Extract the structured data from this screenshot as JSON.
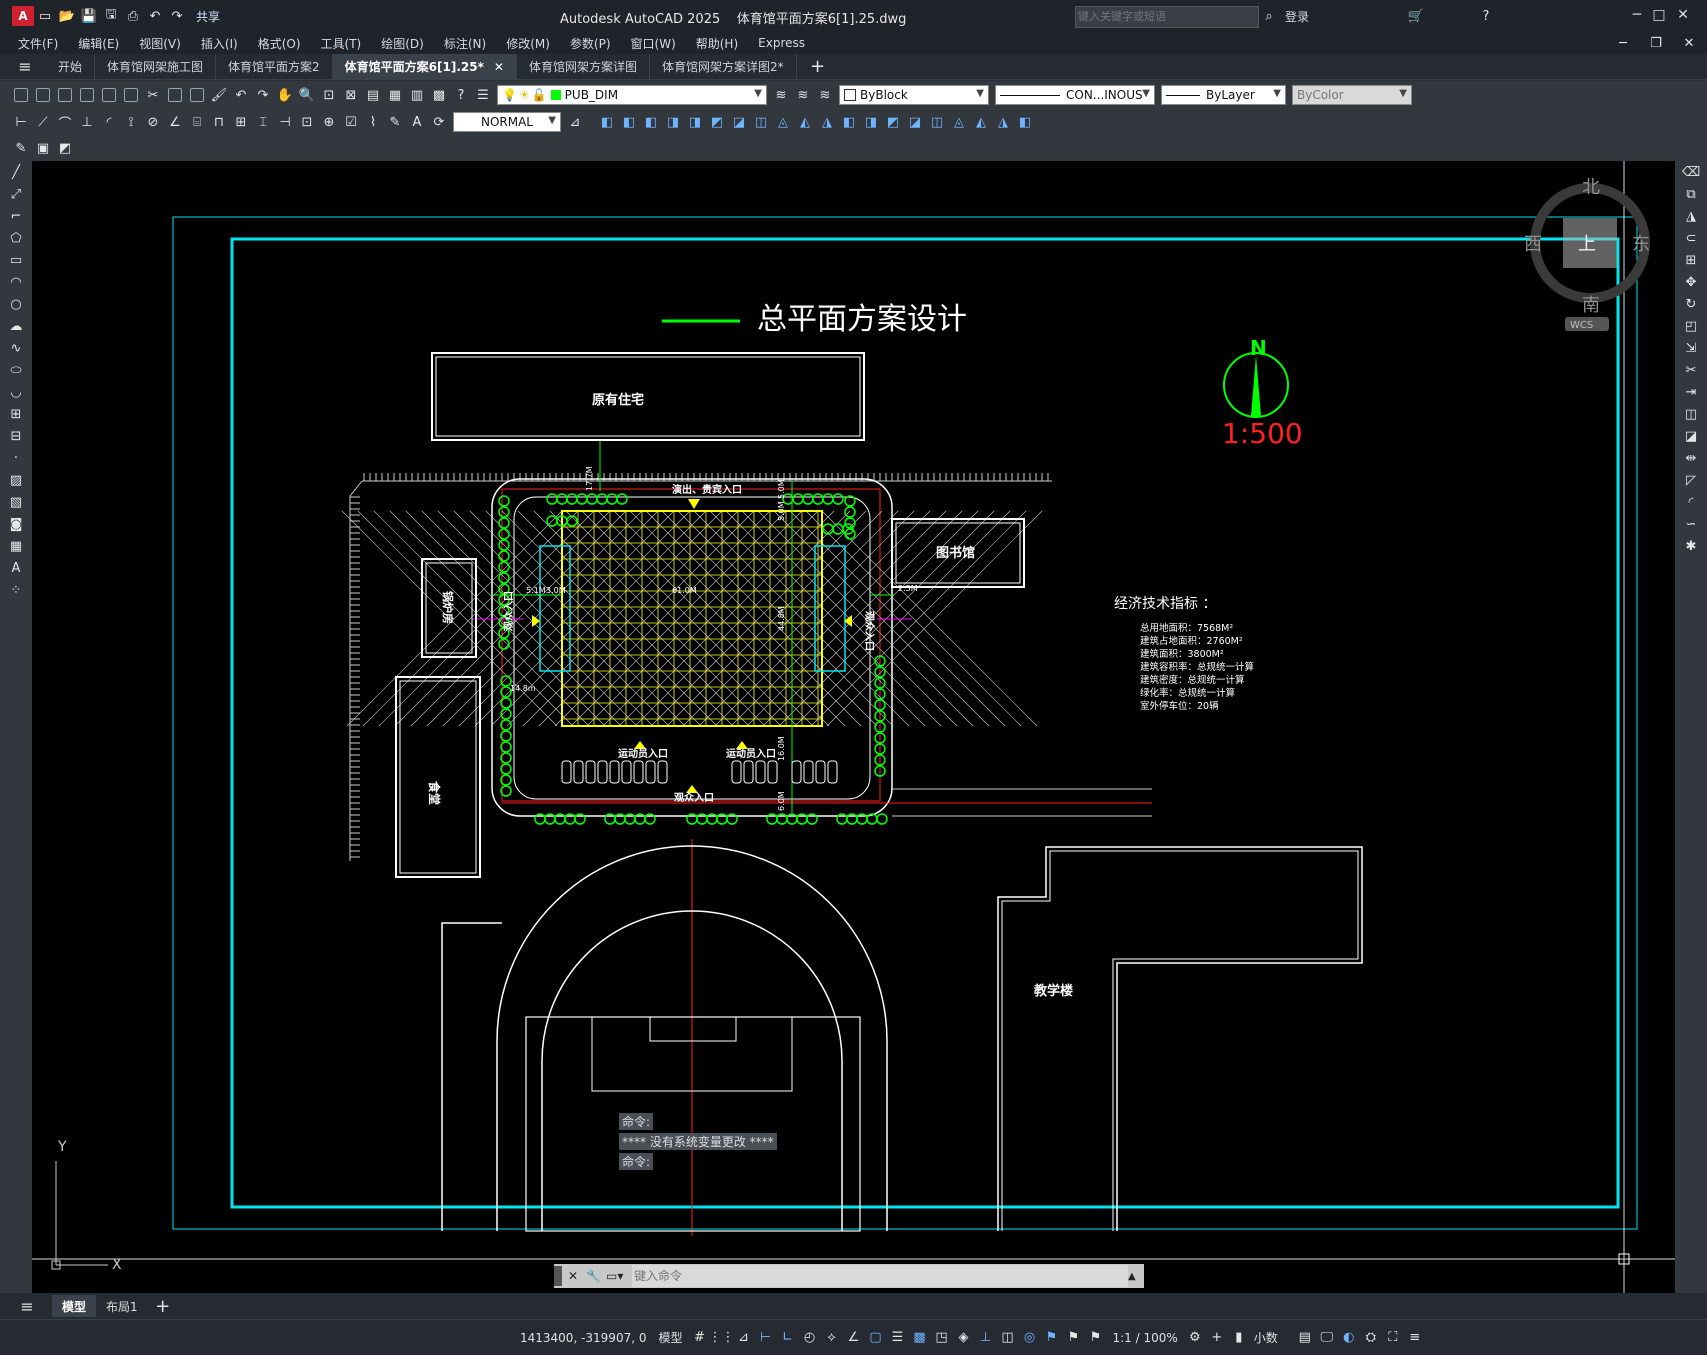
{
  "titlebar": {
    "app_badge": "A",
    "share": "共享",
    "app_title": "Autodesk AutoCAD 2025",
    "file_title": "体育馆平面方案6[1].25.dwg",
    "search_placeholder": "键入关键字或短语",
    "login": "登录"
  },
  "menus": [
    "文件(F)",
    "编辑(E)",
    "视图(V)",
    "插入(I)",
    "格式(O)",
    "工具(T)",
    "绘图(D)",
    "标注(N)",
    "修改(M)",
    "参数(P)",
    "窗口(W)",
    "帮助(H)",
    "Express"
  ],
  "tabs": [
    {
      "label": "开始"
    },
    {
      "label": "体育馆网架施工图"
    },
    {
      "label": "体育馆平面方案2"
    },
    {
      "label": "体育馆平面方案6[1].25*"
    },
    {
      "label": "体育馆网架方案详图"
    },
    {
      "label": "体育馆网架方案详图2*"
    }
  ],
  "toolbar": {
    "layer": "PUB_DIM",
    "color": "ByBlock",
    "linetype": "CON...INOUS",
    "lineweight": "ByLayer",
    "plotstyle": "ByColor",
    "dimstyle": "NORMAL"
  },
  "drawing": {
    "title": "总平面方案设计",
    "north": "N",
    "scale": "1:500",
    "buildings": {
      "residential": "原有住宅",
      "library": "图书馆",
      "shop": "锅炉房",
      "canteen": "食堂",
      "teaching": "教学楼"
    },
    "entrances": {
      "top": "演出、贵宾入口",
      "left": "观众入口",
      "right": "观众入口",
      "bottom": "观众入口",
      "athlete_left": "运动员入口",
      "athlete_right": "运动员入口"
    },
    "dims": [
      "17.7M",
      "5.0M",
      "5.0M",
      "5.1M",
      "3.0M",
      "61.0M",
      "14.8m",
      "16.0M",
      "6.0M",
      "2.5M",
      "44.8M"
    ],
    "econ_title": "经济技术指标 ：",
    "econ_lines": [
      "总用地面积：7568M²",
      "建筑占地面积：2760M²",
      "建筑面积：3800M²",
      "建筑容积率：总规统一计算",
      "建筑密度：总规统一计算",
      "绿化率：总规统一计算",
      "室外停车位：20辆"
    ]
  },
  "viewcube": {
    "n": "北",
    "s": "南",
    "e": "东",
    "w": "西",
    "face": "上",
    "wcs": "WCS"
  },
  "commandline": {
    "line1": "命令:",
    "line2": "**** 没有系统变量更改 ****",
    "line3": "命令:",
    "placeholder": "键入命令"
  },
  "layout_tabs": [
    "模型",
    "布局1"
  ],
  "status": {
    "coords": "1413400, -319907, 0",
    "model": "模型",
    "scale": "1:1 / 100%",
    "units": "小数"
  },
  "colors": {
    "cyan": "#00e5ee",
    "green": "#00ff00",
    "red": "#ff2020",
    "yellow": "#ffff00"
  }
}
